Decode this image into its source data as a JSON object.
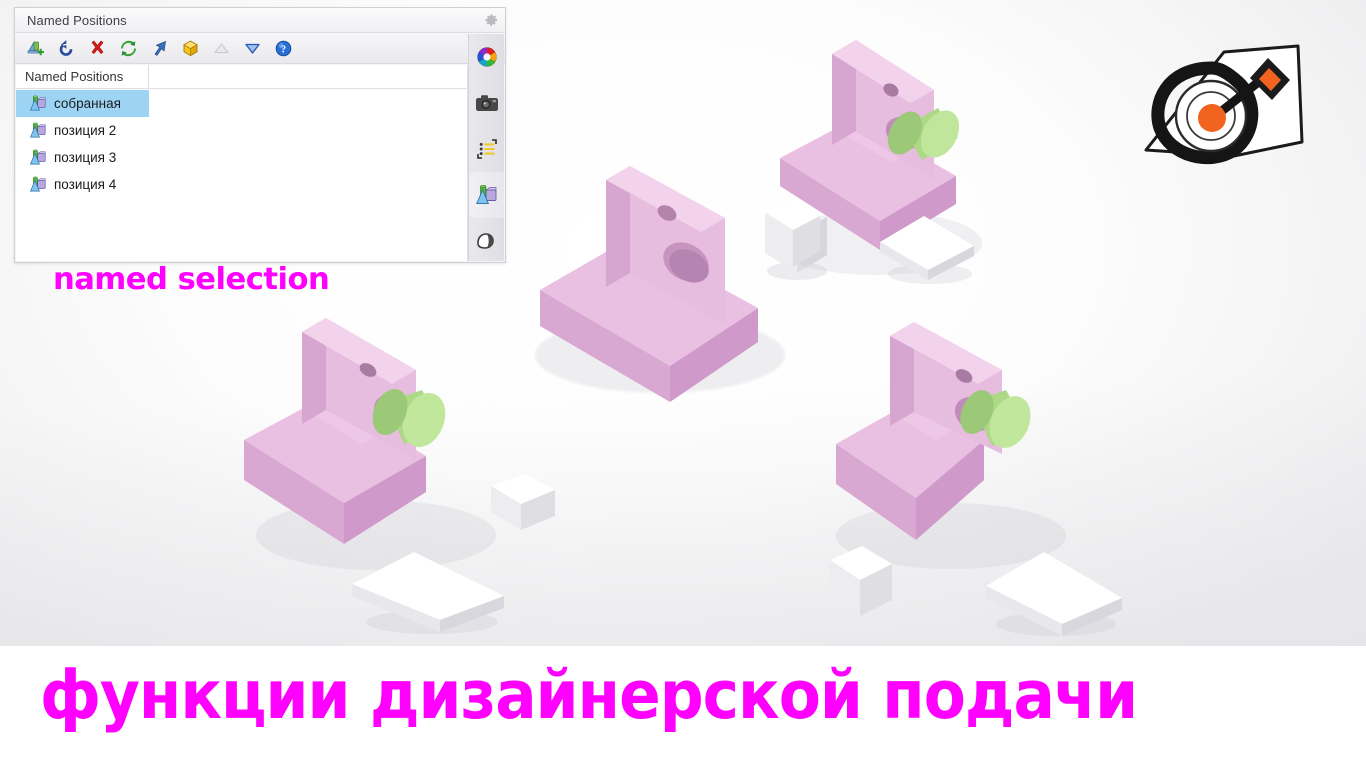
{
  "panel": {
    "title": "Named Positions",
    "gear_icon": "gear-icon",
    "toolbar": [
      {
        "id": "add-position",
        "name": "add-named-position-icon",
        "label": "Add Named Position",
        "enabled": true
      },
      {
        "id": "restore",
        "name": "restore-position-icon",
        "label": "Restore",
        "enabled": true
      },
      {
        "id": "delete",
        "name": "delete-icon",
        "label": "Delete",
        "enabled": true
      },
      {
        "id": "update",
        "name": "refresh-icon",
        "label": "Update",
        "enabled": true
      },
      {
        "id": "goto",
        "name": "arrow-cursor-icon",
        "label": "Go To",
        "enabled": true
      },
      {
        "id": "component",
        "name": "cube-icon",
        "label": "Component",
        "enabled": true
      },
      {
        "id": "move-up",
        "name": "triangle-up-icon",
        "label": "Move Up",
        "enabled": false
      },
      {
        "id": "move-down",
        "name": "triangle-down-icon",
        "label": "Move Down",
        "enabled": true
      },
      {
        "id": "help",
        "name": "help-icon",
        "label": "Help",
        "enabled": true
      }
    ],
    "list": {
      "column_header": "Named Positions",
      "rows": [
        {
          "label": "собранная",
          "selected": true
        },
        {
          "label": "позиция 2",
          "selected": false
        },
        {
          "label": "позиция 3",
          "selected": false
        },
        {
          "label": "позиция 4",
          "selected": false
        }
      ]
    },
    "side_tabs": [
      {
        "id": "appearance",
        "name": "color-wheel-icon",
        "label": "Appearances",
        "active": false
      },
      {
        "id": "camera",
        "name": "camera-icon",
        "label": "Cameras",
        "active": false
      },
      {
        "id": "scenes",
        "name": "list-icon",
        "label": "Scenes",
        "active": false
      },
      {
        "id": "positions",
        "name": "named-positions-icon",
        "label": "Named Positions",
        "active": true
      },
      {
        "id": "render",
        "name": "render-icon",
        "label": "Render",
        "active": false
      }
    ]
  },
  "captions": {
    "named_selection": "named selection",
    "bottom": "функции дизайнерской подачи",
    "color": "#ff00ff"
  },
  "logo": {
    "name": "brand-sketch-logo",
    "accent_color": "#f2631f",
    "outline_color": "#1b1b1b"
  },
  "viewport": {
    "name": "3d-viewport",
    "background": "#fbfbfc",
    "part_colors": {
      "bracket": "#e8bcdf",
      "pin": "#b3e08a",
      "block": "#ffffff"
    },
    "assemblies": [
      {
        "id": "asm-top-center",
        "parts": [
          "bracket",
          "white-box"
        ]
      },
      {
        "id": "asm-top-right",
        "parts": [
          "bracket",
          "green-pin",
          "white-box",
          "white-plate"
        ]
      },
      {
        "id": "asm-bottom-left",
        "parts": [
          "bracket",
          "green-pin",
          "white-box",
          "white-plate"
        ]
      },
      {
        "id": "asm-bottom-right",
        "parts": [
          "bracket",
          "green-pin",
          "white-box",
          "white-plate"
        ]
      }
    ]
  }
}
